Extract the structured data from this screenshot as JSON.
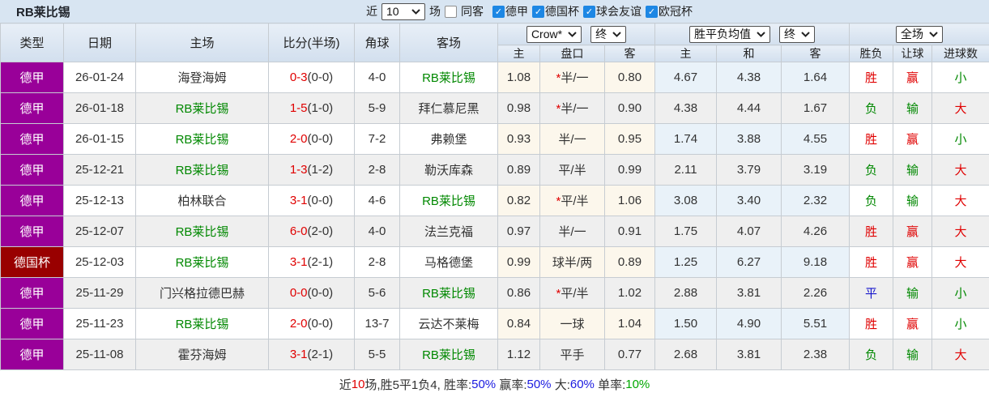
{
  "topbar": {
    "team_title": "RB莱比锡",
    "near_label": "近",
    "matches_count": "10",
    "matches_unit_label": "场",
    "same_opponent_label": "同客",
    "same_opponent_checked": false,
    "competitions": [
      {
        "label": "德甲",
        "checked": true
      },
      {
        "label": "德国杯",
        "checked": true
      },
      {
        "label": "球会友谊",
        "checked": true
      },
      {
        "label": "欧冠杯",
        "checked": true
      }
    ]
  },
  "table": {
    "columns": [
      "类型",
      "日期",
      "主场",
      "比分(半场)",
      "角球",
      "客场"
    ],
    "sub_columns": [
      "主",
      "盘口",
      "客",
      "主",
      "和",
      "客",
      "胜负",
      "让球",
      "进球数"
    ],
    "odds_group1": {
      "bookmaker_select": "Crow*",
      "stage_select": "终"
    },
    "odds_group2": {
      "type_select": "胜平负均值",
      "stage_select": "终"
    },
    "result_group": {
      "scope_select": "全场"
    },
    "rows": [
      {
        "type": "德甲",
        "type_bg": "#990099",
        "date": "26-01-24",
        "home": "海登海姆",
        "home_color": "black",
        "score": "0-3",
        "half": "(0-0)",
        "corner": "4-0",
        "away": "RB莱比锡",
        "away_color": "green",
        "h_odds": "1.08",
        "star": "*",
        "handicap": "半/一",
        "a_odds": "0.80",
        "win": "4.67",
        "draw": "4.38",
        "lose": "1.64",
        "result": "胜",
        "result_color": "red",
        "spread": "赢",
        "spread_color": "red",
        "goals": "小",
        "goals_color": "green"
      },
      {
        "type": "德甲",
        "type_bg": "#990099",
        "date": "26-01-18",
        "home": "RB莱比锡",
        "home_color": "green",
        "score": "1-5",
        "half": "(1-0)",
        "corner": "5-9",
        "away": "拜仁慕尼黑",
        "away_color": "black",
        "h_odds": "0.98",
        "star": "*",
        "handicap": "半/一",
        "a_odds": "0.90",
        "win": "4.38",
        "draw": "4.44",
        "lose": "1.67",
        "result": "负",
        "result_color": "green",
        "spread": "输",
        "spread_color": "green",
        "goals": "大",
        "goals_color": "red"
      },
      {
        "type": "德甲",
        "type_bg": "#990099",
        "date": "26-01-15",
        "home": "RB莱比锡",
        "home_color": "green",
        "score": "2-0",
        "half": "(0-0)",
        "corner": "7-2",
        "away": "弗赖堡",
        "away_color": "black",
        "h_odds": "0.93",
        "star": "",
        "handicap": "半/一",
        "a_odds": "0.95",
        "win": "1.74",
        "draw": "3.88",
        "lose": "4.55",
        "result": "胜",
        "result_color": "red",
        "spread": "赢",
        "spread_color": "red",
        "goals": "小",
        "goals_color": "green"
      },
      {
        "type": "德甲",
        "type_bg": "#990099",
        "date": "25-12-21",
        "home": "RB莱比锡",
        "home_color": "green",
        "score": "1-3",
        "half": "(1-2)",
        "corner": "2-8",
        "away": "勒沃库森",
        "away_color": "black",
        "h_odds": "0.89",
        "star": "",
        "handicap": "平/半",
        "a_odds": "0.99",
        "win": "2.11",
        "draw": "3.79",
        "lose": "3.19",
        "result": "负",
        "result_color": "green",
        "spread": "输",
        "spread_color": "green",
        "goals": "大",
        "goals_color": "red"
      },
      {
        "type": "德甲",
        "type_bg": "#990099",
        "date": "25-12-13",
        "home": "柏林联合",
        "home_color": "black",
        "score": "3-1",
        "half": "(0-0)",
        "corner": "4-6",
        "away": "RB莱比锡",
        "away_color": "green",
        "h_odds": "0.82",
        "star": "*",
        "handicap": "平/半",
        "a_odds": "1.06",
        "win": "3.08",
        "draw": "3.40",
        "lose": "2.32",
        "result": "负",
        "result_color": "green",
        "spread": "输",
        "spread_color": "green",
        "goals": "大",
        "goals_color": "red"
      },
      {
        "type": "德甲",
        "type_bg": "#990099",
        "date": "25-12-07",
        "home": "RB莱比锡",
        "home_color": "green",
        "score": "6-0",
        "half": "(2-0)",
        "corner": "4-0",
        "away": "法兰克福",
        "away_color": "black",
        "h_odds": "0.97",
        "star": "",
        "handicap": "半/一",
        "a_odds": "0.91",
        "win": "1.75",
        "draw": "4.07",
        "lose": "4.26",
        "result": "胜",
        "result_color": "red",
        "spread": "赢",
        "spread_color": "red",
        "goals": "大",
        "goals_color": "red"
      },
      {
        "type": "德国杯",
        "type_bg": "#990000",
        "date": "25-12-03",
        "home": "RB莱比锡",
        "home_color": "green",
        "score": "3-1",
        "half": "(2-1)",
        "corner": "2-8",
        "away": "马格德堡",
        "away_color": "black",
        "h_odds": "0.99",
        "star": "",
        "handicap": "球半/两",
        "a_odds": "0.89",
        "win": "1.25",
        "draw": "6.27",
        "lose": "9.18",
        "result": "胜",
        "result_color": "red",
        "spread": "赢",
        "spread_color": "red",
        "goals": "大",
        "goals_color": "red"
      },
      {
        "type": "德甲",
        "type_bg": "#990099",
        "date": "25-11-29",
        "home": "门兴格拉德巴赫",
        "home_color": "black",
        "score": "0-0",
        "half": "(0-0)",
        "corner": "5-6",
        "away": "RB莱比锡",
        "away_color": "green",
        "h_odds": "0.86",
        "star": "*",
        "handicap": "平/半",
        "a_odds": "1.02",
        "win": "2.88",
        "draw": "3.81",
        "lose": "2.26",
        "result": "平",
        "result_color": "blue",
        "spread": "输",
        "spread_color": "green",
        "goals": "小",
        "goals_color": "green"
      },
      {
        "type": "德甲",
        "type_bg": "#990099",
        "date": "25-11-23",
        "home": "RB莱比锡",
        "home_color": "green",
        "score": "2-0",
        "half": "(0-0)",
        "corner": "13-7",
        "away": "云达不莱梅",
        "away_color": "black",
        "h_odds": "0.84",
        "star": "",
        "handicap": "一球",
        "a_odds": "1.04",
        "win": "1.50",
        "draw": "4.90",
        "lose": "5.51",
        "result": "胜",
        "result_color": "red",
        "spread": "赢",
        "spread_color": "red",
        "goals": "小",
        "goals_color": "green"
      },
      {
        "type": "德甲",
        "type_bg": "#990099",
        "date": "25-11-08",
        "home": "霍芬海姆",
        "home_color": "black",
        "score": "3-1",
        "half": "(2-1)",
        "corner": "5-5",
        "away": "RB莱比锡",
        "away_color": "green",
        "h_odds": "1.12",
        "star": "",
        "handicap": "平手",
        "a_odds": "0.77",
        "win": "2.68",
        "draw": "3.81",
        "lose": "2.38",
        "result": "负",
        "result_color": "green",
        "spread": "输",
        "spread_color": "green",
        "goals": "大",
        "goals_color": "red"
      }
    ]
  },
  "footer": {
    "segments": [
      {
        "text": "近",
        "color": "black"
      },
      {
        "text": "10",
        "color": "red"
      },
      {
        "text": "场,胜5平1负4, 胜率:",
        "color": "black"
      },
      {
        "text": "50%",
        "color": "blue"
      },
      {
        "text": " 赢率:",
        "color": "black"
      },
      {
        "text": "50%",
        "color": "blue"
      },
      {
        "text": " 大:",
        "color": "black"
      },
      {
        "text": "60%",
        "color": "blue"
      },
      {
        "text": " 单率:",
        "color": "black"
      },
      {
        "text": "10%",
        "color": "green"
      }
    ]
  },
  "colors": {
    "league_badge": "#990099",
    "cup_badge": "#990000",
    "team_highlight_green": "#008800",
    "score_red": "#e00000",
    "draw_blue": "#1515cc",
    "checkbox_blue": "#1d87e4",
    "topbar_bg": "#d8e5f2",
    "odds_cream_bg": "#fcf7ec",
    "odds_blue_bg": "#e9f2f9"
  }
}
